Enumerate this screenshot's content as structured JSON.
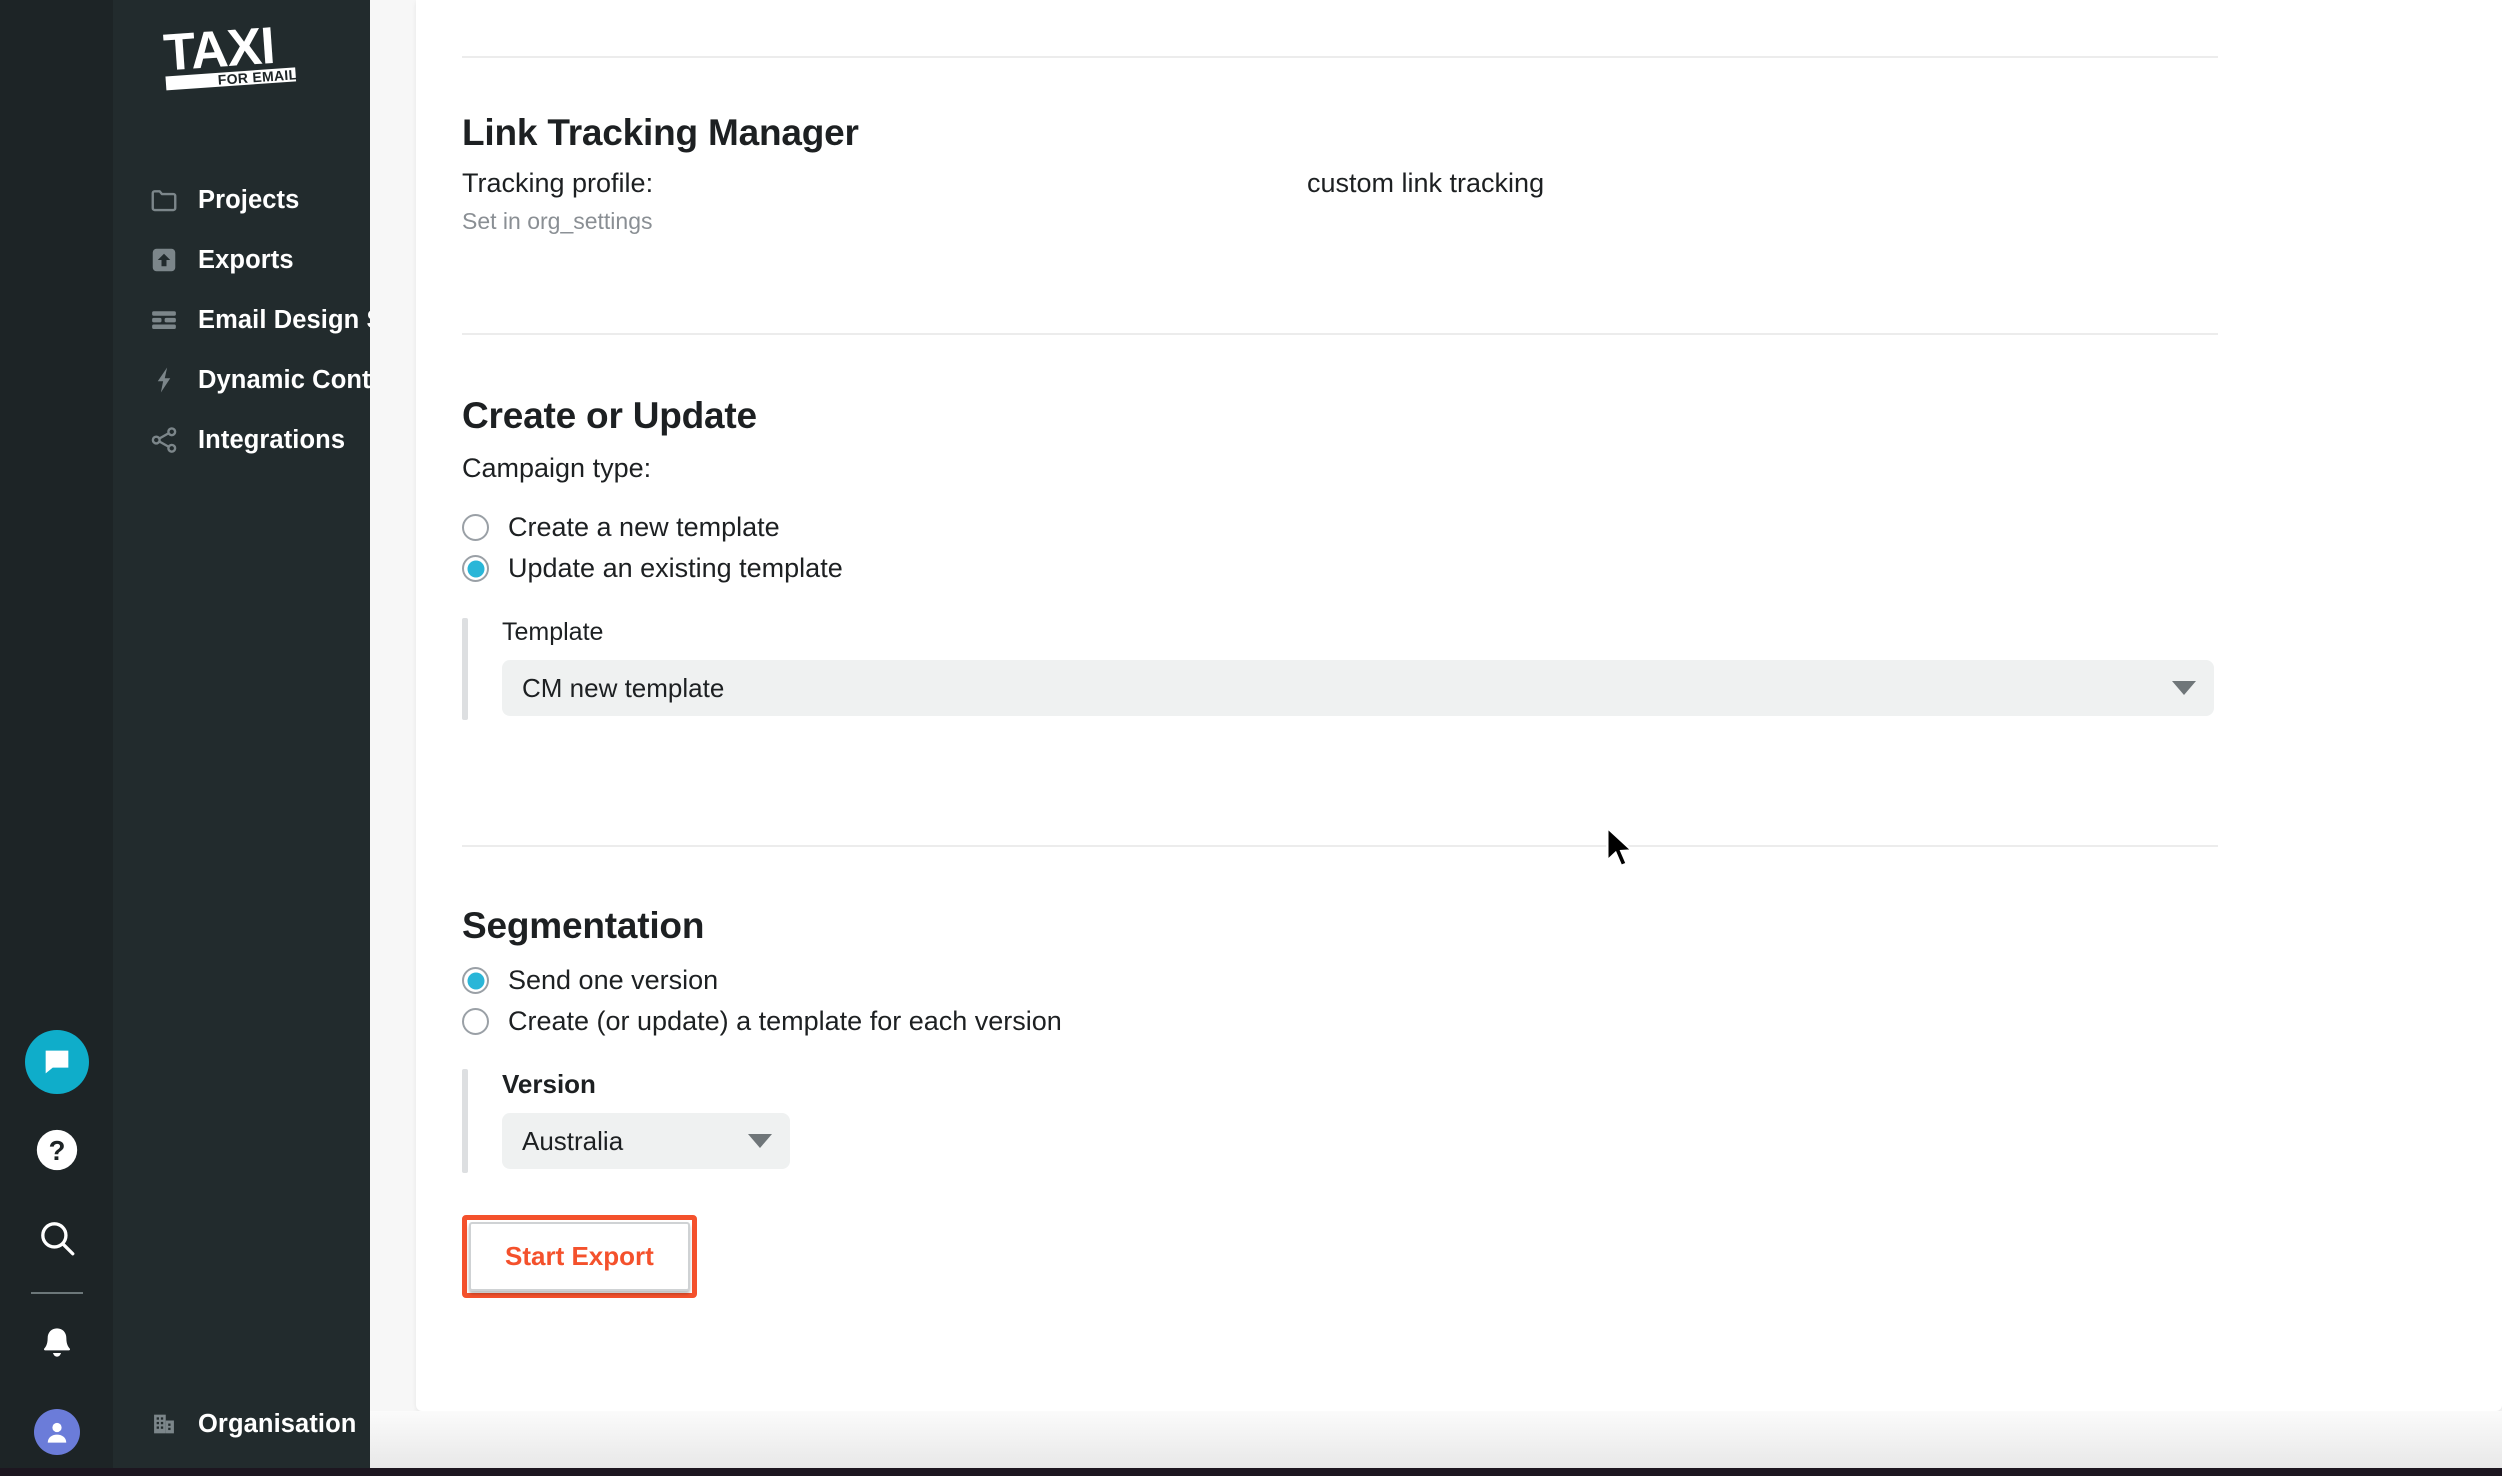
{
  "brand": {
    "logo_text": "TAXI",
    "logo_subtext": "FOR EMAIL",
    "accent_color": "#f4512c",
    "radio_color": "#29b6d8",
    "chat_color": "#0fadca",
    "sidebar_color": "#222b2d",
    "rail_color": "#1d2426"
  },
  "rail": {
    "items": [
      {
        "icon": "chat-bubble-icon",
        "name": "messenger-launcher"
      },
      {
        "icon": "question-mark-icon",
        "name": "help-button"
      },
      {
        "icon": "search-icon",
        "name": "search-button"
      },
      {
        "icon": "bell-icon",
        "name": "notifications-button"
      },
      {
        "icon": "user-avatar-icon",
        "name": "account-avatar"
      }
    ]
  },
  "sidebar": {
    "items": [
      {
        "label": "Projects",
        "icon": "folder-icon"
      },
      {
        "label": "Exports",
        "icon": "upload-icon"
      },
      {
        "label": "Email Design Systems",
        "icon": "design-system-icon"
      },
      {
        "label": "Dynamic Content",
        "icon": "lightning-bolt-icon"
      },
      {
        "label": "Integrations",
        "icon": "share-nodes-icon"
      }
    ],
    "organisation": {
      "label": "Organisation",
      "icon": "building-icon",
      "caret": "chevron-right-icon"
    }
  },
  "main": {
    "link_tracking": {
      "title": "Link Tracking Manager",
      "profile_label": "Tracking profile:",
      "profile_value": "custom link tracking",
      "note": "Set in org_settings"
    },
    "create_or_update": {
      "title": "Create or Update",
      "campaign_type_label": "Campaign type:",
      "options": [
        {
          "label": "Create a new template",
          "selected": false
        },
        {
          "label": "Update an existing template",
          "selected": true
        }
      ],
      "template_field": {
        "label": "Template",
        "value": "CM new template",
        "caret": "chevron-down-icon"
      }
    },
    "segmentation": {
      "title": "Segmentation",
      "options": [
        {
          "label": "Send one version",
          "selected": true
        },
        {
          "label": "Create (or update) a template for each version",
          "selected": false
        }
      ],
      "version_field": {
        "label": "Version",
        "value": "Australia",
        "caret": "chevron-down-icon"
      }
    },
    "start_export_button": "Start Export"
  }
}
